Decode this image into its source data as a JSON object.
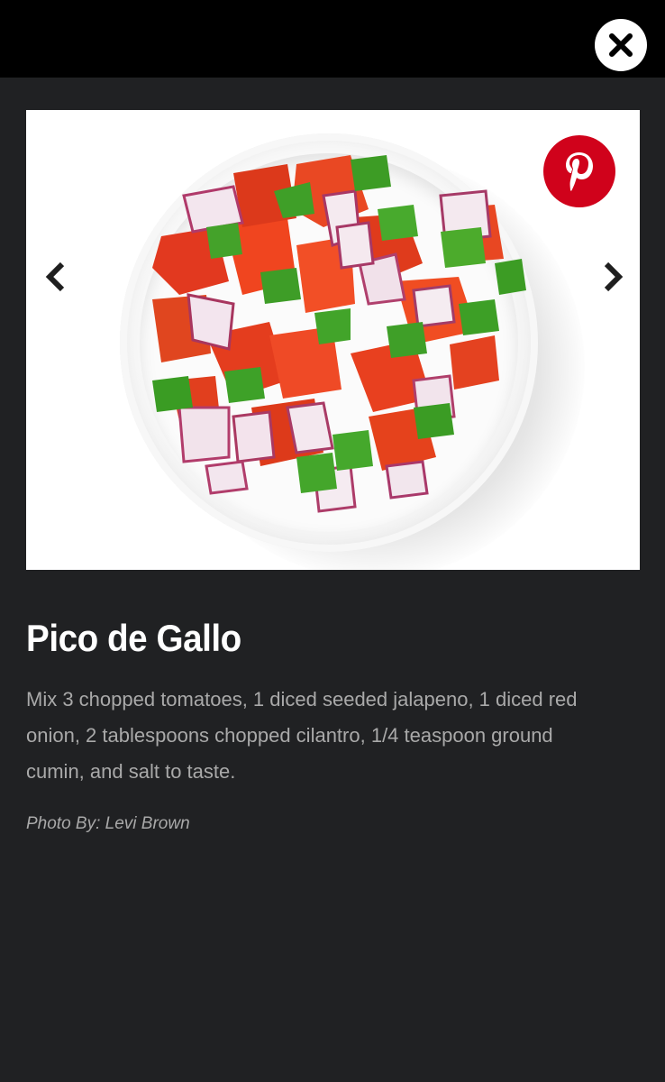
{
  "modal": {
    "close_icon": "close-icon",
    "pinterest_icon": "pinterest-icon",
    "prev_icon": "chevron-left-icon",
    "next_icon": "chevron-right-icon",
    "colors": {
      "topbar": "#000000",
      "background": "#202123",
      "pinterest": "#d0021b",
      "title": "#ffffff",
      "body_text": "#a9a9a9"
    }
  },
  "slide": {
    "title": "Pico de Gallo",
    "description": "Mix 3 chopped tomatoes, 1 diced seeded jalapeno, 1 diced red onion, 2 tablespoons chopped cilantro, 1/4 teaspoon ground cumin, and salt to taste.",
    "credit": "Photo By: Levi Brown"
  }
}
